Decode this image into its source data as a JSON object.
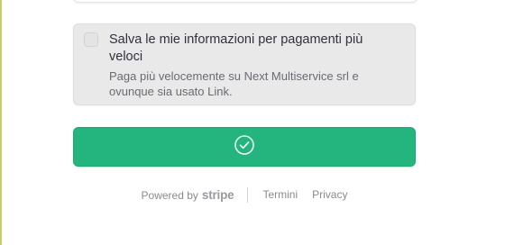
{
  "save_info": {
    "title": "Salva le mie informazioni per pagamenti più veloci",
    "description": "Paga più velocemente su Next Multiservice srl e ovunque sia usato Link.",
    "checked": false
  },
  "pay_button": {
    "icon": "check-circle-icon",
    "color": "#24b47e"
  },
  "footer": {
    "powered_by": "Powered by",
    "brand": "stripe",
    "links": [
      "Termini",
      "Privacy"
    ]
  }
}
